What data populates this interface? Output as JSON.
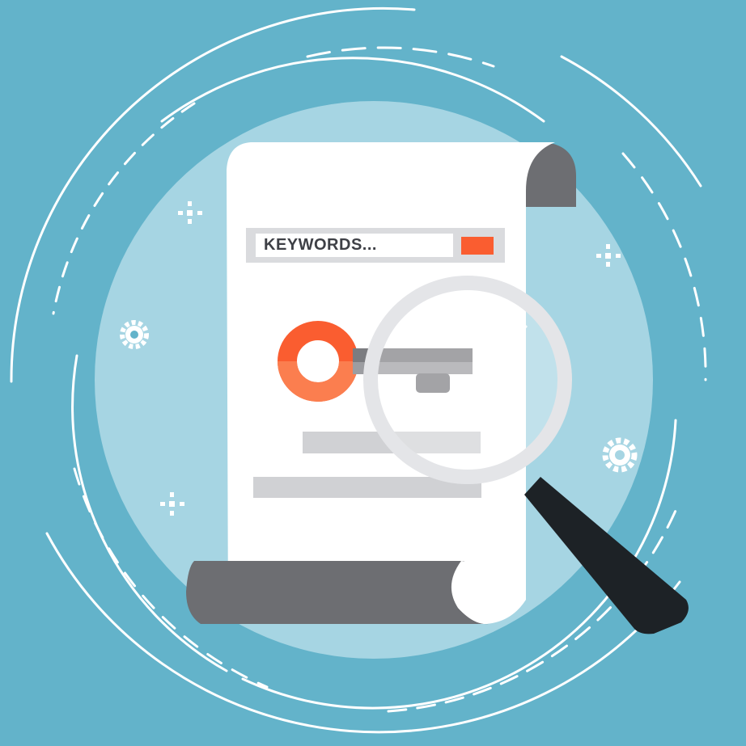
{
  "search_bar": {
    "text": "KEYWORDS..."
  },
  "icons": [
    "sparkle-icon",
    "gear-icon",
    "key-icon",
    "magnifying-glass-icon",
    "scroll-document-icon"
  ],
  "colors": {
    "background": "#63b3ca",
    "inner_circle": "#a6d5e3",
    "paper": "#ffffff",
    "scroll_curl": "#6d6e72",
    "accent_orange": "#fa5d30",
    "handle": "#1d2226",
    "placeholder_line": "#d0d1d4"
  }
}
